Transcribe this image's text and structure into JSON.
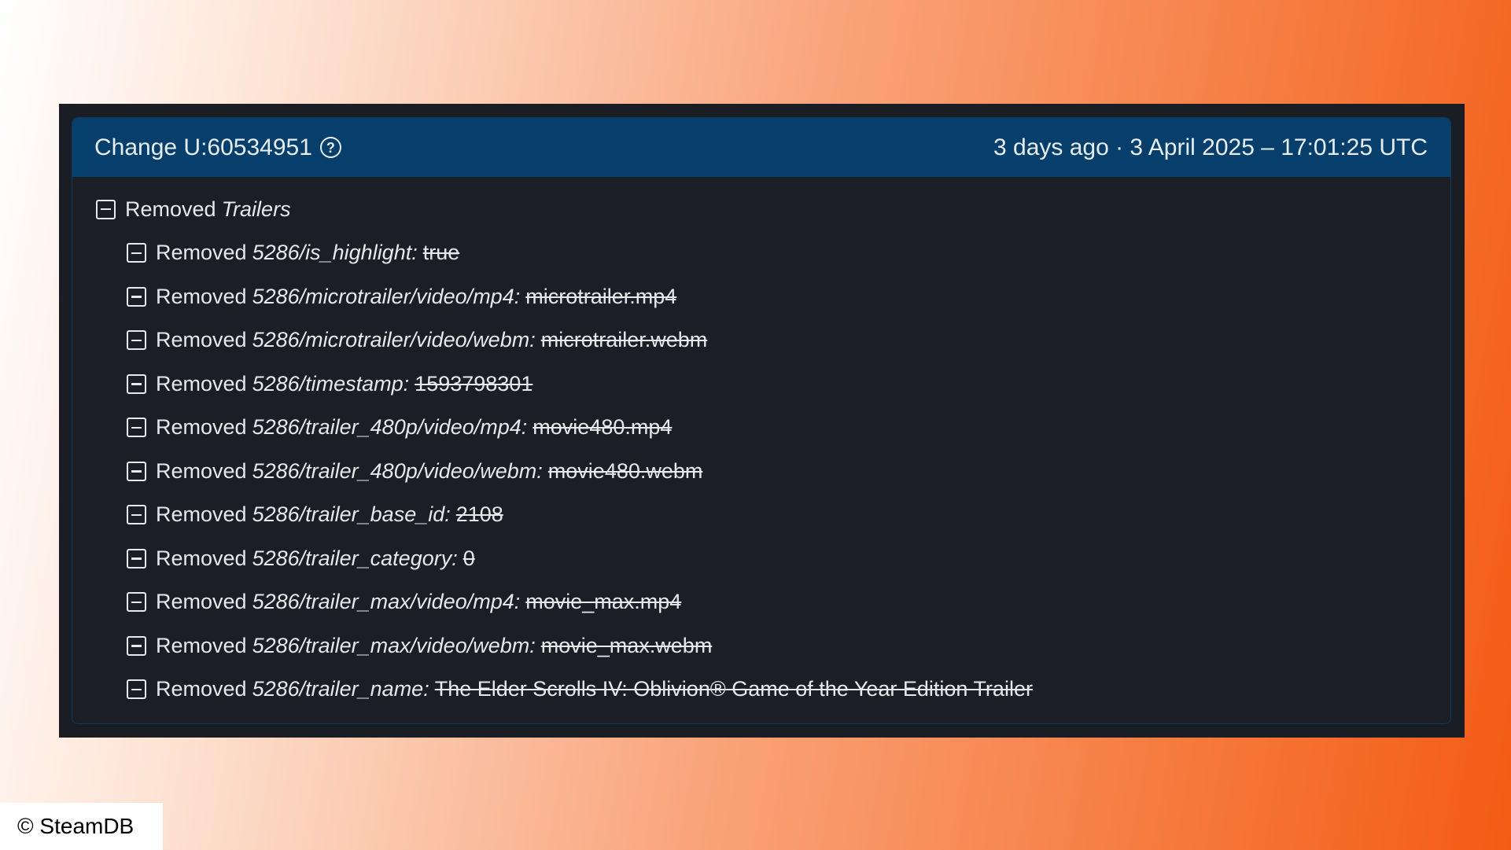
{
  "header": {
    "title": "Change U:60534951",
    "timestamp": "3 days ago · 3 April 2025 – 17:01:25 UTC"
  },
  "root": {
    "verb": "Removed",
    "section": "Trailers"
  },
  "changes": [
    {
      "verb": "Removed",
      "key": "5286/is_highlight:",
      "value": "true"
    },
    {
      "verb": "Removed",
      "key": "5286/microtrailer/video/mp4:",
      "value": "microtrailer.mp4"
    },
    {
      "verb": "Removed",
      "key": "5286/microtrailer/video/webm:",
      "value": "microtrailer.webm"
    },
    {
      "verb": "Removed",
      "key": "5286/timestamp:",
      "value": "1593798301"
    },
    {
      "verb": "Removed",
      "key": "5286/trailer_480p/video/mp4:",
      "value": "movie480.mp4"
    },
    {
      "verb": "Removed",
      "key": "5286/trailer_480p/video/webm:",
      "value": "movie480.webm"
    },
    {
      "verb": "Removed",
      "key": "5286/trailer_base_id:",
      "value": "2108"
    },
    {
      "verb": "Removed",
      "key": "5286/trailer_category:",
      "value": "0"
    },
    {
      "verb": "Removed",
      "key": "5286/trailer_max/video/mp4:",
      "value": "movie_max.mp4"
    },
    {
      "verb": "Removed",
      "key": "5286/trailer_max/video/webm:",
      "value": "movie_max.webm"
    },
    {
      "verb": "Removed",
      "key": "5286/trailer_name:",
      "value": "The Elder Scrolls IV: Oblivion® Game of the Year Edition Trailer"
    }
  ],
  "credit": "© SteamDB",
  "icons": {
    "help": "help-circle-icon",
    "collapse": "minus-square-icon"
  },
  "colors": {
    "header_bg": "#063f6b",
    "panel_bg": "#1b1e24",
    "text": "#e6e8eb"
  }
}
